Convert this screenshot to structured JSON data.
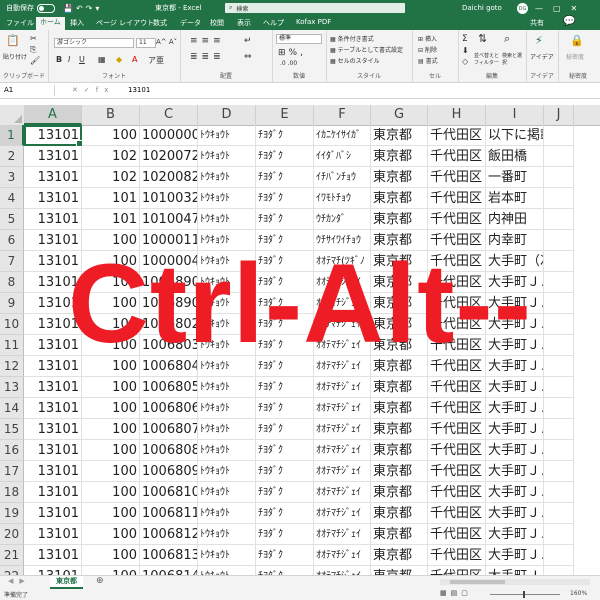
{
  "titlebar": {
    "autosave": "自動保存",
    "toggle_state": "オフ",
    "doc_title": "東京都 - Excel",
    "search_placeholder": "検索",
    "user": "Daichi goto",
    "avatar": "DG"
  },
  "tabs": [
    "ファイル",
    "ホーム",
    "挿入",
    "ページ レイアウト",
    "数式",
    "データ",
    "校閲",
    "表示",
    "ヘルプ",
    "Kofax PDF"
  ],
  "active_tab": "ホーム",
  "share": "共有",
  "ribbon": {
    "clipboard": {
      "label": "クリップボード",
      "paste": "貼り付け"
    },
    "font": {
      "label": "フォント",
      "name": "游ゴシック",
      "size": "11"
    },
    "alignment": {
      "label": "配置"
    },
    "number": {
      "label": "数値",
      "format": "標準"
    },
    "styles": {
      "label": "スタイル",
      "conditional": "条件付き書式",
      "table": "テーブルとして書式設定",
      "cell_styles": "セルのスタイル"
    },
    "cells": {
      "label": "セル",
      "insert": "挿入",
      "delete": "削除",
      "format": "書式"
    },
    "editing": {
      "label": "編集",
      "sort": "並べ替えとフィルター",
      "find": "検索と選択"
    },
    "ideas": {
      "label": "アイデア",
      "btn": "アイデア"
    },
    "sensitivity": {
      "label": "秘密度",
      "btn": "秘密度"
    }
  },
  "formula_bar": {
    "name_box": "A1",
    "content": "13101"
  },
  "columns": [
    "A",
    "B",
    "C",
    "D",
    "E",
    "F",
    "G",
    "H",
    "I",
    "J"
  ],
  "rows": [
    {
      "n": "1",
      "cells": [
        "13101",
        "100",
        "1000000",
        "ﾄｳｷｮｳﾄ",
        "ﾁﾖﾀﾞｸ",
        "ｲｶﾆｹｲｻｲｶﾞ",
        "東京都",
        "千代田区",
        "以下に掲載"
      ]
    },
    {
      "n": "2",
      "cells": [
        "13101",
        "102",
        "1020072",
        "ﾄｳｷｮｳﾄ",
        "ﾁﾖﾀﾞｸ",
        "ｲｲﾀﾞﾊﾞｼ",
        "東京都",
        "千代田区",
        "飯田橋"
      ]
    },
    {
      "n": "3",
      "cells": [
        "13101",
        "102",
        "1020082",
        "ﾄｳｷｮｳﾄ",
        "ﾁﾖﾀﾞｸ",
        "ｲﾁﾊﾞﾝﾁｮｳ",
        "東京都",
        "千代田区",
        "一番町"
      ]
    },
    {
      "n": "4",
      "cells": [
        "13101",
        "101",
        "1010032",
        "ﾄｳｷｮｳﾄ",
        "ﾁﾖﾀﾞｸ",
        "ｲﾜﾓﾄﾁｮｳ",
        "東京都",
        "千代田区",
        "岩本町"
      ]
    },
    {
      "n": "5",
      "cells": [
        "13101",
        "101",
        "1010047",
        "ﾄｳｷｮｳﾄ",
        "ﾁﾖﾀﾞｸ",
        "ｳﾁｶﾝﾀﾞ",
        "東京都",
        "千代田区",
        "内神田"
      ]
    },
    {
      "n": "6",
      "cells": [
        "13101",
        "100",
        "1000011",
        "ﾄｳｷｮｳﾄ",
        "ﾁﾖﾀﾞｸ",
        "ｳﾁｻｲﾜｲﾁｮｳ",
        "東京都",
        "千代田区",
        "内幸町"
      ]
    },
    {
      "n": "7",
      "cells": [
        "13101",
        "100",
        "1000004",
        "ﾄｳｷｮｳﾄ",
        "ﾁﾖﾀﾞｸ",
        "ｵｵﾃﾏﾁ(ﾂｷﾞﾉ",
        "東京都",
        "千代田区",
        "大手町（次"
      ]
    },
    {
      "n": "8",
      "cells": [
        "13101",
        "100",
        "1006890",
        "ﾄｳｷｮｳﾄ",
        "ﾁﾖﾀﾞｸ",
        "ｵｵﾃﾏﾁｼﾞｪｲ",
        "東京都",
        "千代田区",
        "大手町ＪＡ"
      ]
    },
    {
      "n": "9",
      "cells": [
        "13101",
        "100",
        "1006890",
        "ﾄｳｷｮｳﾄ",
        "ﾁﾖﾀﾞｸ",
        "ｵｵﾃﾏﾁｼﾞｪｲ",
        "東京都",
        "千代田区",
        "大手町ＪＡ"
      ]
    },
    {
      "n": "10",
      "cells": [
        "13101",
        "100",
        "1006802",
        "ﾄｳｷｮｳﾄ",
        "ﾁﾖﾀﾞｸ",
        "ｵｵﾃﾏﾁｼﾞｪｲ",
        "東京都",
        "千代田区",
        "大手町ＪＡ"
      ]
    },
    {
      "n": "11",
      "cells": [
        "13101",
        "100",
        "1006803",
        "ﾄｳｷｮｳﾄ",
        "ﾁﾖﾀﾞｸ",
        "ｵｵﾃﾏﾁｼﾞｪｲ",
        "東京都",
        "千代田区",
        "大手町ＪＡ"
      ]
    },
    {
      "n": "12",
      "cells": [
        "13101",
        "100",
        "1006804",
        "ﾄｳｷｮｳﾄ",
        "ﾁﾖﾀﾞｸ",
        "ｵｵﾃﾏﾁｼﾞｪｲ",
        "東京都",
        "千代田区",
        "大手町ＪＡ"
      ]
    },
    {
      "n": "13",
      "cells": [
        "13101",
        "100",
        "1006805",
        "ﾄｳｷｮｳﾄ",
        "ﾁﾖﾀﾞｸ",
        "ｵｵﾃﾏﾁｼﾞｪｲ",
        "東京都",
        "千代田区",
        "大手町ＪＡ"
      ]
    },
    {
      "n": "14",
      "cells": [
        "13101",
        "100",
        "1006806",
        "ﾄｳｷｮｳﾄ",
        "ﾁﾖﾀﾞｸ",
        "ｵｵﾃﾏﾁｼﾞｪｲ",
        "東京都",
        "千代田区",
        "大手町ＪＡ"
      ]
    },
    {
      "n": "15",
      "cells": [
        "13101",
        "100",
        "1006807",
        "ﾄｳｷｮｳﾄ",
        "ﾁﾖﾀﾞｸ",
        "ｵｵﾃﾏﾁｼﾞｪｲ",
        "東京都",
        "千代田区",
        "大手町ＪＡ"
      ]
    },
    {
      "n": "16",
      "cells": [
        "13101",
        "100",
        "1006808",
        "ﾄｳｷｮｳﾄ",
        "ﾁﾖﾀﾞｸ",
        "ｵｵﾃﾏﾁｼﾞｪｲ",
        "東京都",
        "千代田区",
        "大手町ＪＡ"
      ]
    },
    {
      "n": "17",
      "cells": [
        "13101",
        "100",
        "1006809",
        "ﾄｳｷｮｳﾄ",
        "ﾁﾖﾀﾞｸ",
        "ｵｵﾃﾏﾁｼﾞｪｲ",
        "東京都",
        "千代田区",
        "大手町ＪＡ"
      ]
    },
    {
      "n": "18",
      "cells": [
        "13101",
        "100",
        "1006810",
        "ﾄｳｷｮｳﾄ",
        "ﾁﾖﾀﾞｸ",
        "ｵｵﾃﾏﾁｼﾞｪｲ",
        "東京都",
        "千代田区",
        "大手町ＪＡ"
      ]
    },
    {
      "n": "19",
      "cells": [
        "13101",
        "100",
        "1006811",
        "ﾄｳｷｮｳﾄ",
        "ﾁﾖﾀﾞｸ",
        "ｵｵﾃﾏﾁｼﾞｪｲ",
        "東京都",
        "千代田区",
        "大手町ＪＡ"
      ]
    },
    {
      "n": "20",
      "cells": [
        "13101",
        "100",
        "1006812",
        "ﾄｳｷｮｳﾄ",
        "ﾁﾖﾀﾞｸ",
        "ｵｵﾃﾏﾁｼﾞｪｲ",
        "東京都",
        "千代田区",
        "大手町ＪＡ"
      ]
    },
    {
      "n": "21",
      "cells": [
        "13101",
        "100",
        "1006813",
        "ﾄｳｷｮｳﾄ",
        "ﾁﾖﾀﾞｸ",
        "ｵｵﾃﾏﾁｼﾞｪｲ",
        "東京都",
        "千代田区",
        "大手町ＪＡ"
      ]
    },
    {
      "n": "22",
      "cells": [
        "13101",
        "100",
        "1006814",
        "ﾄｳｷｮｳﾄ",
        "ﾁﾖﾀﾞｸ",
        "ｵｵﾃﾏﾁｼﾞｪｲ",
        "東京都",
        "千代田区",
        "大手町ＪＡ"
      ]
    },
    {
      "n": "23",
      "cells": [
        "13101",
        "100",
        "1006815",
        "ﾄｳｷｮｳﾄ",
        "ﾁﾖﾀﾞｸ",
        "ｵｵﾃﾏﾁｼﾞｪｲ",
        "東京都",
        "千代田区",
        "大手町ＪＡ"
      ]
    }
  ],
  "overlay_text": "Ctrl-Alt--",
  "sheet_tab": "東京都",
  "status": "準備完了",
  "zoom": "160%",
  "colors": {
    "excel_green": "#217346",
    "overlay_red": "#ee1c24"
  }
}
